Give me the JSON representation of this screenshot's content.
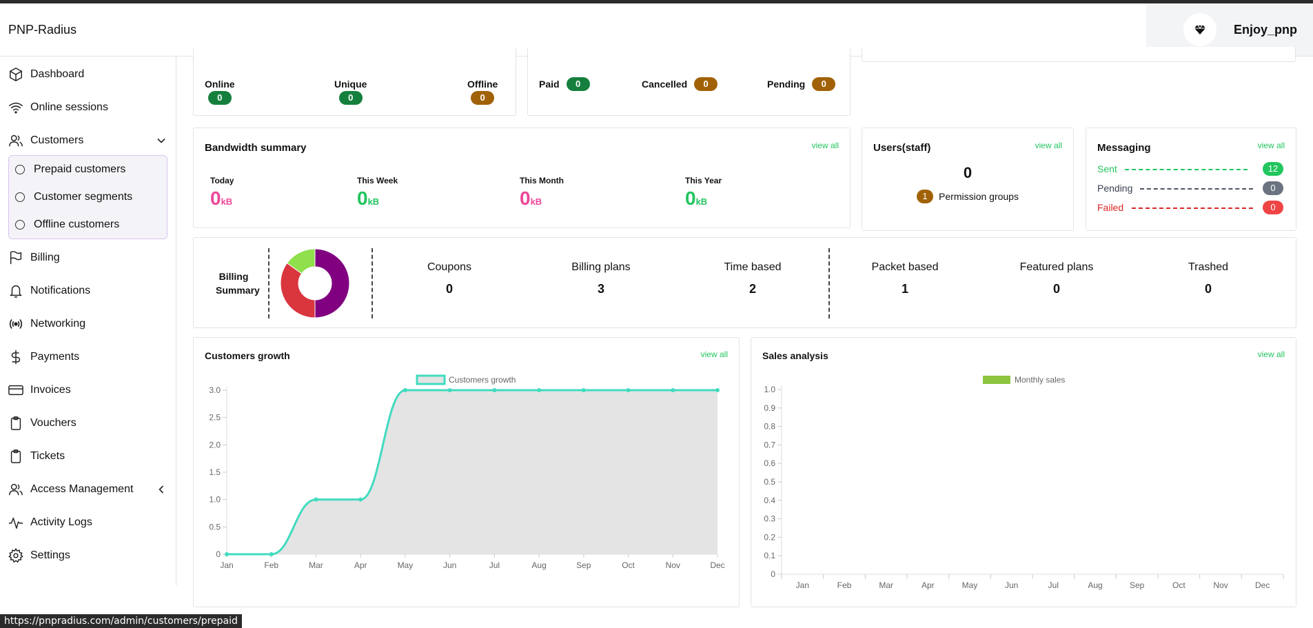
{
  "header": {
    "brand": "PNP-Radius",
    "user_name": "Enjoy_pnp"
  },
  "sidebar": {
    "items": [
      {
        "label": "Dashboard",
        "icon": "cube-icon"
      },
      {
        "label": "Online sessions",
        "icon": "wifi-icon"
      },
      {
        "label": "Customers",
        "icon": "users-icon"
      },
      {
        "label": "Billing",
        "icon": "flag-icon"
      },
      {
        "label": "Notifications",
        "icon": "bell-icon"
      },
      {
        "label": "Networking",
        "icon": "broadcast-icon"
      },
      {
        "label": "Payments",
        "icon": "dollar-icon"
      },
      {
        "label": "Invoices",
        "icon": "credit-card-icon"
      },
      {
        "label": "Vouchers",
        "icon": "clipboard-icon"
      },
      {
        "label": "Tickets",
        "icon": "clipboard-icon"
      },
      {
        "label": "Access Management",
        "icon": "users-icon"
      },
      {
        "label": "Activity Logs",
        "icon": "activity-icon"
      },
      {
        "label": "Settings",
        "icon": "gear-icon"
      }
    ],
    "customers_sub": [
      {
        "label": "Prepaid customers"
      },
      {
        "label": "Customer segments"
      },
      {
        "label": "Offline customers"
      }
    ]
  },
  "sessions": {
    "online_label": "Online",
    "online": "0",
    "unique_label": "Unique",
    "unique": "0",
    "offline_label": "Offline",
    "offline": "0"
  },
  "payments": {
    "paid_label": "Paid",
    "paid": "0",
    "cancelled_label": "Cancelled",
    "cancelled": "0",
    "pending_label": "Pending",
    "pending": "0"
  },
  "bandwidth": {
    "title": "Bandwidth summary",
    "view_all": "view all",
    "today_label": "Today",
    "today": "0",
    "week_label": "This Week",
    "week": "0",
    "month_label": "This Month",
    "month": "0",
    "year_label": "This Year",
    "year": "0",
    "unit": "kB"
  },
  "staff": {
    "title": "Users(staff)",
    "view_all": "view all",
    "count": "0",
    "perm_count": "1",
    "perm_label": "Permission groups"
  },
  "messaging": {
    "title": "Messaging",
    "view_all": "view all",
    "sent_label": "Sent",
    "sent": "12",
    "pending_label": "Pending",
    "pending": "0",
    "failed_label": "Failed",
    "failed": "0",
    "colors": {
      "sent": "#22c55e",
      "pending": "#4b5563",
      "failed": "#dc2626"
    }
  },
  "billing_summary": {
    "title_line1": "Billing",
    "title_line2": "Summary",
    "donut": [
      {
        "value": 50,
        "color": "#800080"
      },
      {
        "value": 35,
        "color": "#d9363e"
      },
      {
        "value": 15,
        "color": "#8fe04c"
      }
    ],
    "stats": [
      {
        "label": "Coupons",
        "value": "0"
      },
      {
        "label": "Billing plans",
        "value": "3"
      },
      {
        "label": "Time based",
        "value": "2"
      },
      {
        "label": "Packet based",
        "value": "1"
      },
      {
        "label": "Featured plans",
        "value": "0"
      },
      {
        "label": "Trashed",
        "value": "0"
      }
    ]
  },
  "growth": {
    "title": "Customers growth",
    "view_all": "view all"
  },
  "sales": {
    "title": "Sales analysis",
    "view_all": "view all"
  },
  "chart_data": [
    {
      "type": "area",
      "legend": "Customers growth",
      "categories": [
        "Jan",
        "Feb",
        "Mar",
        "Apr",
        "May",
        "Jun",
        "Jul",
        "Aug",
        "Sep",
        "Oct",
        "Nov",
        "Dec"
      ],
      "series": [
        {
          "name": "Customers growth",
          "values": [
            0,
            0,
            1,
            1,
            3,
            3,
            3,
            3,
            3,
            3,
            3,
            3
          ]
        }
      ],
      "yticks": [
        "0",
        "0.5",
        "1.0",
        "1.5",
        "2.0",
        "2.5",
        "3.0"
      ],
      "ylim": [
        0,
        3
      ],
      "line_color": "#40dbbf",
      "fill_color": "#e4e4e4"
    },
    {
      "type": "bar",
      "legend": "Monthly sales",
      "categories": [
        "Jan",
        "Feb",
        "Mar",
        "Apr",
        "May",
        "Jun",
        "Jul",
        "Aug",
        "Sep",
        "Oct",
        "Nov",
        "Dec"
      ],
      "series": [
        {
          "name": "Monthly sales",
          "values": [
            0,
            0,
            0,
            0,
            0,
            0,
            0,
            0,
            0,
            0,
            0,
            0
          ]
        }
      ],
      "yticks": [
        "0",
        "0.1",
        "0.2",
        "0.3",
        "0.4",
        "0.5",
        "0.6",
        "0.7",
        "0.8",
        "0.9",
        "1.0"
      ],
      "ylim": [
        0,
        1
      ],
      "bar_color": "#8cc63f"
    }
  ],
  "status_url": "https://pnpradius.com/admin/customers/prepaid"
}
